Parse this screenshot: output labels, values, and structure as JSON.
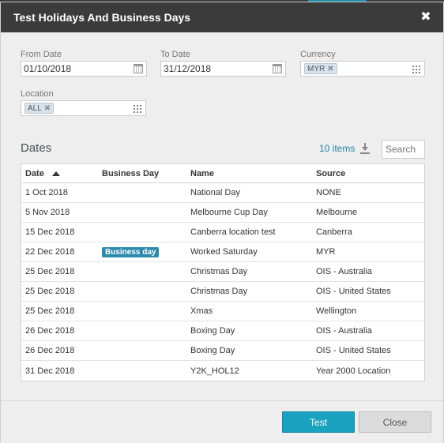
{
  "dialog": {
    "title": "Test Holidays And Business Days"
  },
  "filters": {
    "from_date": {
      "label": "From Date",
      "value": "01/10/2018"
    },
    "to_date": {
      "label": "To Date",
      "value": "31/12/2018"
    },
    "currency": {
      "label": "Currency",
      "chip": "MYR"
    },
    "location": {
      "label": "Location",
      "chip": "ALL"
    }
  },
  "dates": {
    "title": "Dates",
    "count": "10 items",
    "search_placeholder": "Search",
    "columns": [
      "Date",
      "Business Day",
      "Name",
      "Source"
    ],
    "rows": [
      {
        "date": "1 Oct 2018",
        "business_day": "",
        "name": "National Day",
        "source": "NONE"
      },
      {
        "date": "5 Nov 2018",
        "business_day": "",
        "name": "Melbourne Cup Day",
        "source": "Melbourne"
      },
      {
        "date": "15 Dec 2018",
        "business_day": "",
        "name": "Canberra location test",
        "source": "Canberra"
      },
      {
        "date": "22 Dec 2018",
        "business_day": "Business day",
        "name": "Worked Saturday",
        "source": "MYR"
      },
      {
        "date": "25 Dec 2018",
        "business_day": "",
        "name": "Christmas Day",
        "source": "OIS - Australia"
      },
      {
        "date": "25 Dec 2018",
        "business_day": "",
        "name": "Christmas Day",
        "source": "OIS - United States"
      },
      {
        "date": "25 Dec 2018",
        "business_day": "",
        "name": "Xmas",
        "source": "Wellington"
      },
      {
        "date": "26 Dec 2018",
        "business_day": "",
        "name": "Boxing Day",
        "source": "OIS - Australia"
      },
      {
        "date": "26 Dec 2018",
        "business_day": "",
        "name": "Boxing Day",
        "source": "OIS - United States"
      },
      {
        "date": "31 Dec 2018",
        "business_day": "",
        "name": "Y2K_HOL12",
        "source": "Year 2000 Location"
      }
    ]
  },
  "buttons": {
    "test": "Test",
    "close": "Close"
  },
  "colors": {
    "accent": "#1aa3c0",
    "titlebar": "#3b3b3b",
    "badge": "#2c8bac"
  },
  "icons": {
    "close": "close-icon",
    "calendar": "calendar-icon",
    "grid": "grid-icon",
    "download": "download-icon",
    "sort": "sort-ascending-icon"
  }
}
